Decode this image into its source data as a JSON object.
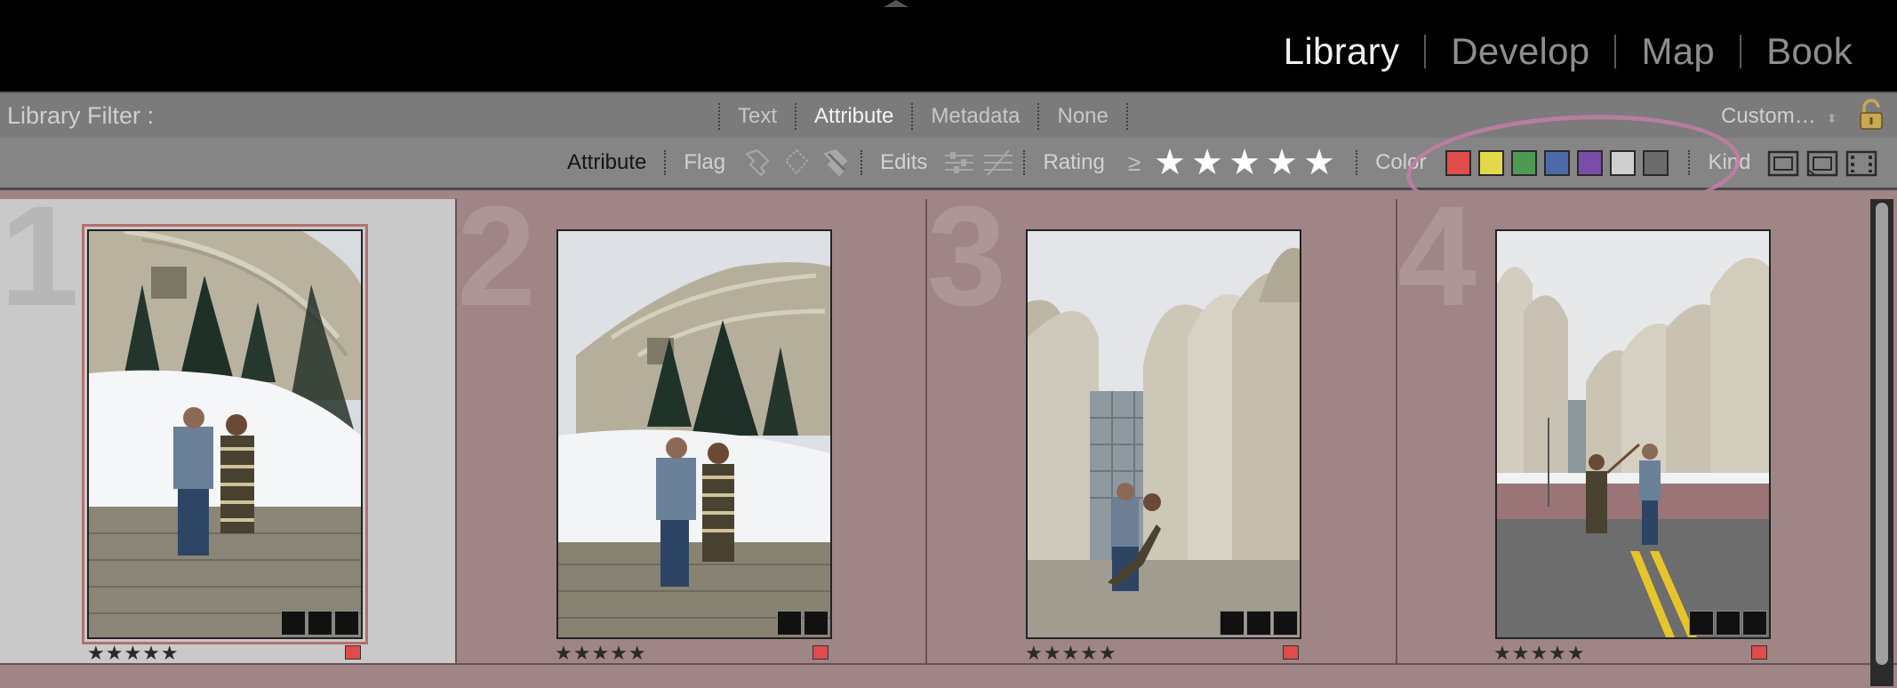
{
  "modules": [
    "Library",
    "Develop",
    "Map",
    "Book"
  ],
  "active_module": "Library",
  "filter_bar": {
    "title": "Library Filter :",
    "tabs": [
      "Text",
      "Attribute",
      "Metadata",
      "None"
    ],
    "active_tab": "Attribute",
    "preset": "Custom…"
  },
  "attribute_bar": {
    "attribute_label": "Attribute",
    "flag_label": "Flag",
    "edits_label": "Edits",
    "rating_label": "Rating",
    "rating_op": "≥",
    "stars": [
      "★",
      "★",
      "★",
      "★",
      "★"
    ],
    "color_label": "Color",
    "colors": [
      "#e04b4b",
      "#e2d84a",
      "#4e9a55",
      "#4c6aa8",
      "#7a4da8",
      "#cfcfcf",
      "#6b6b6b"
    ],
    "kind_label": "Kind"
  },
  "grid": {
    "cells": [
      {
        "number": "1",
        "rating": "★★★★★",
        "label_color": "#e04b4b",
        "selected": true
      },
      {
        "number": "2",
        "rating": "★★★★★",
        "label_color": "#e04b4b",
        "selected": false
      },
      {
        "number": "3",
        "rating": "★★★★★",
        "label_color": "#e04b4b",
        "selected": false
      },
      {
        "number": "4",
        "rating": "★★★★★",
        "label_color": "#e04b4b",
        "selected": false
      }
    ]
  }
}
